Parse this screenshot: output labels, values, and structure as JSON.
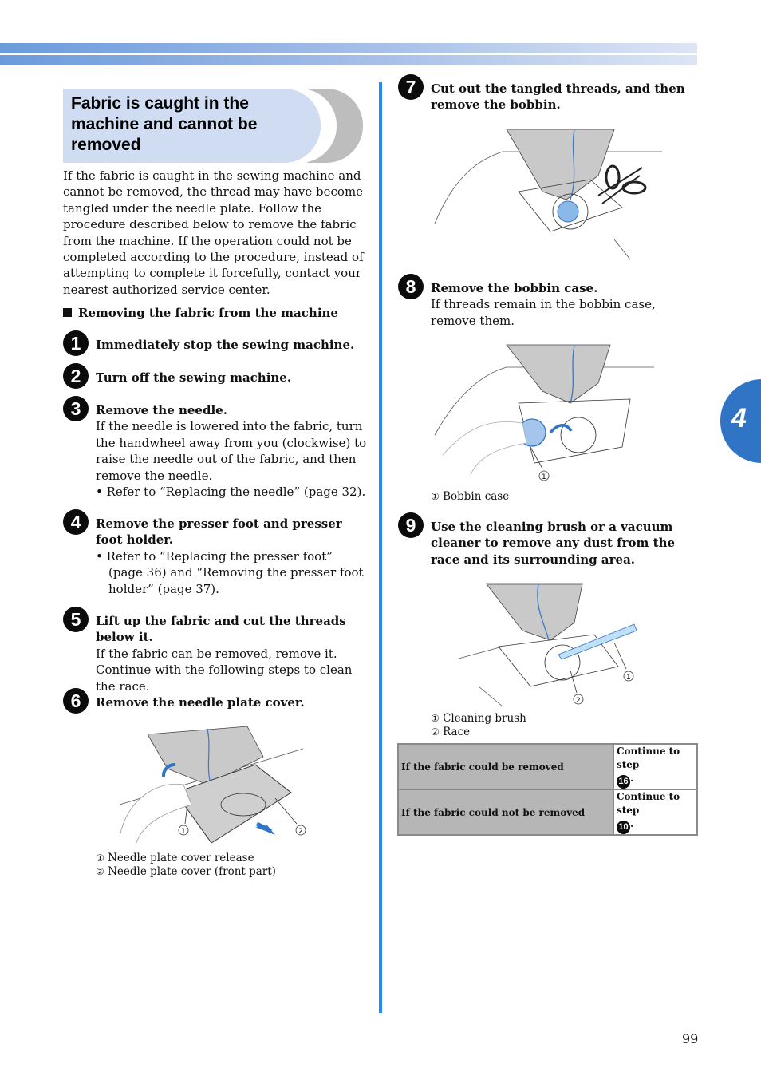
{
  "page": {
    "chapter_number": "4",
    "page_number": "99",
    "colors": {
      "accent_blue": "#2f74c5",
      "divider_blue": "#2a8be6",
      "title_bg": "#cfdcf2",
      "table_grey": "#b6b6b6"
    }
  },
  "section": {
    "title": "Fabric is caught in the machine and cannot be removed",
    "intro": "If the fabric is caught in the sewing machine and cannot be removed, the thread may have become tangled under the needle plate. Follow the procedure described below to remove the fabric from the machine. If the operation could not be completed according to the procedure, instead of attempting to complete it forcefully, contact your nearest authorized service center.",
    "subheading": "Removing the fabric from the machine"
  },
  "steps": [
    {
      "num": "1",
      "heading": "Immediately stop the sewing machine."
    },
    {
      "num": "2",
      "heading": "Turn off the sewing machine."
    },
    {
      "num": "3",
      "heading": "Remove the needle.",
      "body": "If the needle is lowered into the fabric, turn the handwheel away from you (clockwise) to raise the needle out of the fabric, and then remove the needle.",
      "bullets": [
        "Refer to “Replacing the needle” (page 32)."
      ]
    },
    {
      "num": "4",
      "heading": "Remove the presser foot and presser foot holder.",
      "bullets": [
        "Refer to “Replacing the presser foot” (page 36) and “Removing the presser foot holder” (page 37)."
      ]
    },
    {
      "num": "5",
      "heading": "Lift up the fabric and cut the threads below it.",
      "body": "If the fabric can be removed, remove it. Continue with the following steps to clean the race."
    },
    {
      "num": "6",
      "heading": "Remove the needle plate cover.",
      "callouts": [
        {
          "n": "①",
          "label": "Needle plate cover release"
        },
        {
          "n": "②",
          "label": "Needle plate cover (front part)"
        }
      ]
    },
    {
      "num": "7",
      "heading": "Cut out the tangled threads, and then remove the bobbin."
    },
    {
      "num": "8",
      "heading": "Remove the bobbin case.",
      "body": "If threads remain in the bobbin case, remove them.",
      "callouts": [
        {
          "n": "①",
          "label": "Bobbin case"
        }
      ]
    },
    {
      "num": "9",
      "heading": "Use the cleaning brush or a vacuum cleaner to remove any dust from the race and its surrounding area.",
      "callouts": [
        {
          "n": "①",
          "label": "Cleaning brush"
        },
        {
          "n": "②",
          "label": "Race"
        }
      ]
    }
  ],
  "table": {
    "rows": [
      {
        "condition": "If the fabric could be removed",
        "action": "Continue to step",
        "step": "16"
      },
      {
        "condition": "If the fabric could not be removed",
        "action": "Continue to step",
        "step": "10"
      }
    ]
  }
}
